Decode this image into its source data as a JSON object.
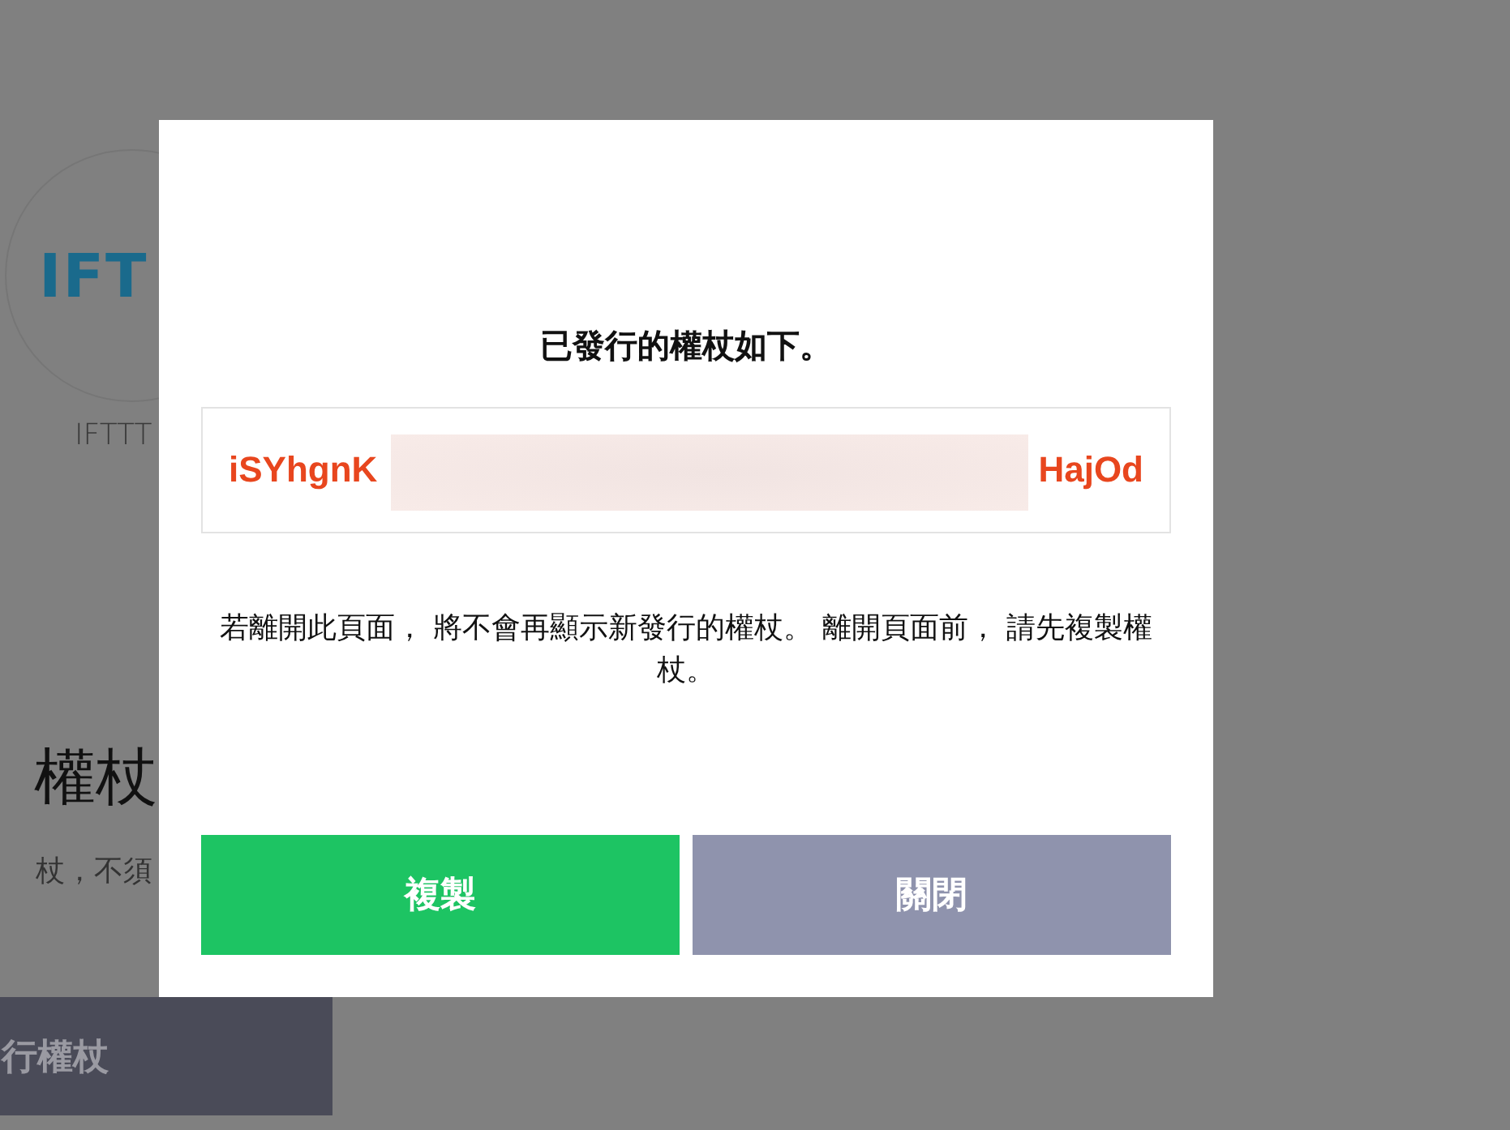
{
  "background_page": {
    "logo": "IFT",
    "service_name": "IFTTT",
    "heading": "權杖",
    "description": "杖，不須",
    "issue_button": "行權杖"
  },
  "dialog": {
    "title": "已發行的權杖如下。",
    "token": {
      "start": "iSYhgnK",
      "end": "HajOd",
      "redacted": true
    },
    "message": "若離開此頁面， 將不會再顯示新發行的權杖。 離開頁面前， 請先複製權杖。",
    "buttons": [
      {
        "label": "複製",
        "kind": "primary"
      },
      {
        "label": "關閉",
        "kind": "secondary"
      }
    ]
  }
}
